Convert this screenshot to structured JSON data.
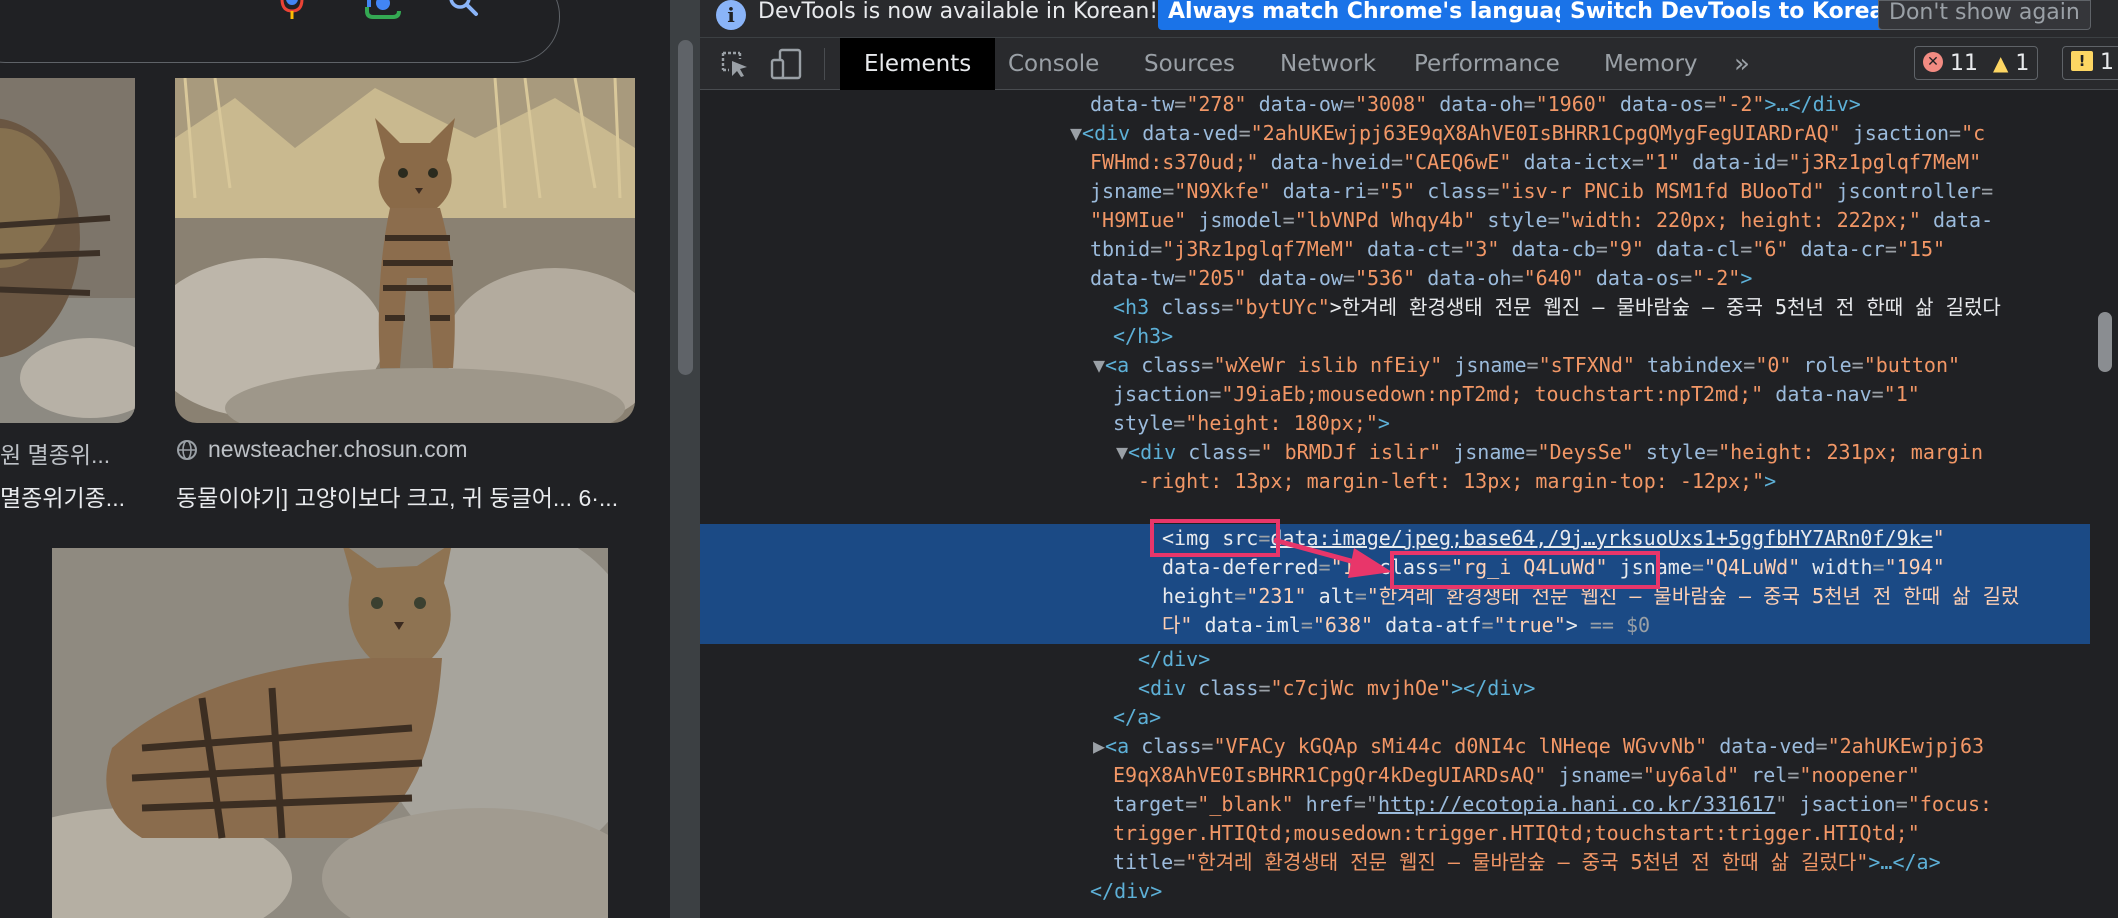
{
  "left": {
    "left_source": "원 멸종위...",
    "left_title": "멸종위기종...",
    "main_source": "newsteacher.chosun.com",
    "main_title": "동물이야기] 고양이보다 크고, 귀 둥글어... 6·..."
  },
  "devtools": {
    "infobar": {
      "message": "DevTools is now available in Korean!",
      "match_label": "Always match Chrome's language",
      "switch_label": "Switch DevTools to Korean",
      "dismiss_label": "Don't show again"
    },
    "tabs": {
      "elements": "Elements",
      "console": "Console",
      "sources": "Sources",
      "network": "Network",
      "performance": "Performance",
      "memory": "Memory",
      "more": "»"
    },
    "counters": {
      "errors": "11",
      "warnings": "1",
      "issues": "1"
    },
    "dom": {
      "l0": {
        "a1": "data-tw",
        "v1": "\"278\"",
        "a2": "data-ow",
        "v2": "\"3008\"",
        "a3": "data-oh",
        "v3": "\"1960\"",
        "a4": "data-os",
        "v4": "\"-2\"",
        "end": ">…</div>"
      },
      "l1": {
        "tri": "▼",
        "tag": "<div",
        "a1": "data-ved",
        "v1": "\"2ahUKEwjpj63E9qX8AhVE0IsBHRR1CpgQMygFegUIARDrAQ\"",
        "a2": "jsaction",
        "v2": "\"c"
      },
      "l2": {
        "v0": "FWHmd:s370ud;\"",
        "a1": "data-hveid",
        "v1": "\"CAEQ6wE\"",
        "a2": "data-ictx",
        "v2": "\"1\"",
        "a3": "data-id",
        "v3": "\"j3Rz1pglqf7MeM\""
      },
      "l3": {
        "a1": "jsname",
        "v1": "\"N9Xkfe\"",
        "a2": "data-ri",
        "v2": "\"5\"",
        "a3": "class",
        "v3": "\"isv-r PNCib MSM1fd BUooTd\"",
        "a4": "jscontroller",
        "eq": "="
      },
      "l4": {
        "v0": "\"H9MIue\"",
        "a1": "jsmodel",
        "v1": "\"lbVNPd Whqy4b\"",
        "a2": "style",
        "v2": "\"width: 220px; height: 222px;\"",
        "a3": "data-"
      },
      "l5": {
        "a0": "tbnid",
        "v0": "\"j3Rz1pglqf7MeM\"",
        "a1": "data-ct",
        "v1": "\"3\"",
        "a2": "data-cb",
        "v2": "\"9\"",
        "a3": "data-cl",
        "v3": "\"6\"",
        "a4": "data-cr",
        "v4": "\"15\""
      },
      "l6": {
        "a1": "data-tw",
        "v1": "\"205\"",
        "a2": "data-ow",
        "v2": "\"536\"",
        "a3": "data-oh",
        "v3": "\"640\"",
        "a4": "data-os",
        "v4": "\"-2\"",
        "end": ">"
      },
      "l7": {
        "tag": "<h3",
        "a1": "class",
        "v1": "\"bytUYc\"",
        "text": ">한겨레 환경생태 전문 웹진 – 물바람숲 – 중국 5천년 전 한때 삶 길렀다"
      },
      "l8": {
        "tag": "</h3>"
      },
      "l9": {
        "tri": "▼",
        "tag": "<a",
        "a1": "class",
        "v1": "\"wXeWr islib nfEiy\"",
        "a2": "jsname",
        "v2": "\"sTFXNd\"",
        "a3": "tabindex",
        "v3": "\"0\"",
        "a4": "role",
        "v4": "\"button\""
      },
      "l10": {
        "a1": "jsaction",
        "v1": "\"J9iaEb;mousedown:npT2md; touchstart:npT2md;\"",
        "a2": "data-nav",
        "v2": "\"1\""
      },
      "l11": {
        "a1": "style",
        "v1": "\"height: 180px;\"",
        "end": ">"
      },
      "l12": {
        "tri": "▼",
        "tag": "<div",
        "a1": "class",
        "v1": "\" bRMDJf islir\"",
        "a2": "jsname",
        "v2": "\"DeysSe\"",
        "a3": "style",
        "v3": "\"height: 231px; margin"
      },
      "l13": {
        "v0": "-right: 13px; margin-left: 13px; margin-top: -12px;\"",
        "end": ">"
      },
      "l14": {
        "tag": "<img",
        "a1": "src",
        "link": "data:image/jpeg;base64,/9j…yrksuoUxs1+5ggfbHY7ARn0f/9k=",
        "q": "\""
      },
      "l15": {
        "a1": "data-deferred",
        "v1": "\"1\"",
        "a2": "class",
        "v2": "\"rg_i Q4LuWd\"",
        "a3": "jsname",
        "v3": "\"Q4LuWd\"",
        "a4": "width",
        "v4": "\"194\""
      },
      "l16": {
        "a1": "height",
        "v1": "\"231\"",
        "a2": "alt",
        "v2": "\"한겨레 환경생태 전문 웹진 – 물바람숲 – 중국 5천년 전 한때 삶 길렀"
      },
      "l17": {
        "v0": "다\"",
        "a1": "data-iml",
        "v1": "\"638\"",
        "a2": "data-atf",
        "v2": "\"true\"",
        "end": ">",
        "sel": " == $0"
      },
      "l18": {
        "tag": "</div>"
      },
      "l19": {
        "tag": "<div",
        "a1": "class",
        "v1": "\"c7cjWc mvjhOe\"",
        "end": "></div>"
      },
      "l20": {
        "tag": "</a>"
      },
      "l21": {
        "tri": "▶",
        "tag": "<a",
        "a1": "class",
        "v1": "\"VFACy kGQAp sMi44c d0NI4c lNHeqe WGvvNb\"",
        "a2": "data-ved",
        "v2": "\"2ahUKEwjpj63"
      },
      "l22": {
        "v0": "E9qX8AhVE0IsBHRR1CpgQr4kDegUIARDsAQ\"",
        "a1": "jsname",
        "v1": "\"uy6ald\"",
        "a2": "rel",
        "v2": "\"noopener\""
      },
      "l23": {
        "a1": "target",
        "v1": "\"_blank\"",
        "a2": "href",
        "link": "http://ecotopia.hani.co.kr/331617",
        "a3": "jsaction",
        "v3": "\"focus:"
      },
      "l24": {
        "v0": "trigger.HTIQtd;mousedown:trigger.HTIQtd;touchstart:trigger.HTIQtd;\""
      },
      "l25": {
        "a1": "title",
        "v1": "\"한겨레 환경생태 전문 웹진 – 물바람숲 – 중국 5천년 전 한때 삶 길렀다\"",
        "end": ">…</a>"
      },
      "l26": {
        "tag": "</div>"
      }
    },
    "selected_marker": "···"
  },
  "colors": {
    "accent": "#1a73e8",
    "highlight": "#1b4a85",
    "annotation": "#e8366a"
  }
}
